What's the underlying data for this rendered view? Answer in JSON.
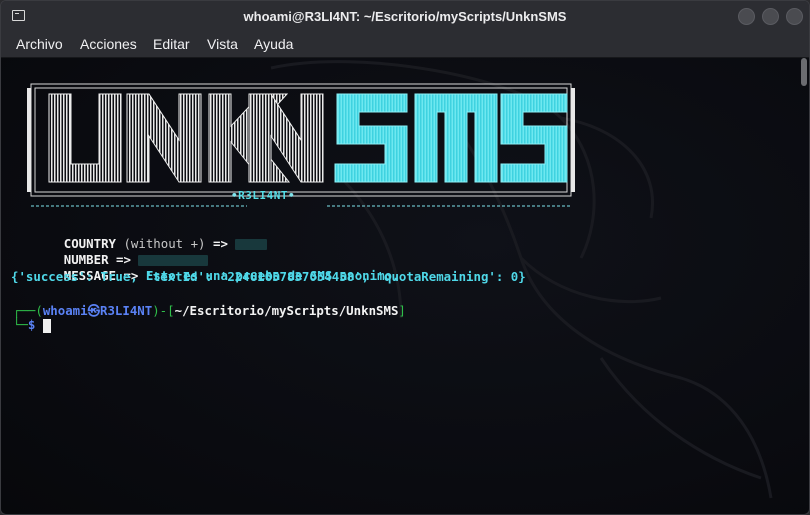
{
  "window": {
    "title": "whoami@R3LI4NT: ~/Escritorio/myScripts/UnknSMS"
  },
  "menu": {
    "items": [
      "Archivo",
      "Acciones",
      "Editar",
      "Vista",
      "Ayuda"
    ]
  },
  "banner": {
    "logo_white": "UNKN",
    "logo_cyan": "SMS",
    "subtitle": "R3LI4NT"
  },
  "output": {
    "country_label": "COUNTRY",
    "country_hint": "(without +)",
    "arrow": "=>",
    "number_label": "NUMBER",
    "message_label": "MESSAGE",
    "message_value": "Esto es una prueba de SMS anonimo.",
    "response": "{'success': True, 'textId': '22461657837054458', 'quotaRemaining': 0}"
  },
  "prompt": {
    "user_host": "whoami㉿R3LI4NT",
    "path": "~/Escritorio/myScripts/UnknSMS",
    "symbol": "$"
  },
  "colors": {
    "accent_cyan": "#4fd8e8",
    "prompt_blue": "#5a82f5",
    "prompt_green": "#2fbf4a"
  }
}
